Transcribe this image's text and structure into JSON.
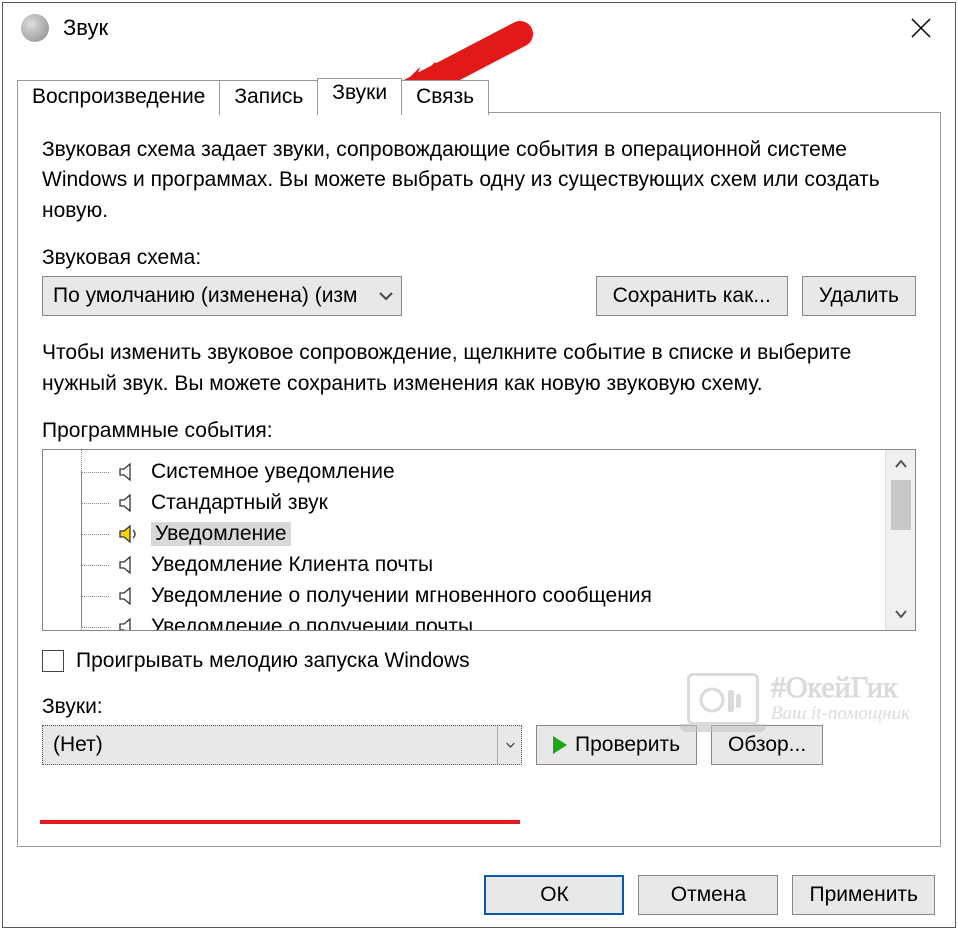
{
  "window": {
    "title": "Звук"
  },
  "tabs": [
    {
      "label": "Воспроизведение",
      "active": false
    },
    {
      "label": "Запись",
      "active": false
    },
    {
      "label": "Звуки",
      "active": true
    },
    {
      "label": "Связь",
      "active": false
    }
  ],
  "description": "Звуковая схема задает звуки, сопровождающие события в операционной системе Windows и программах. Вы можете выбрать одну из существующих схем или создать новую.",
  "scheme": {
    "label": "Звуковая схема:",
    "value": "По умолчанию (изменена) (изм",
    "save_as": "Сохранить как...",
    "delete": "Удалить"
  },
  "events_help": "Чтобы изменить звуковое сопровождение, щелкните событие в списке и выберите нужный звук. Вы можете сохранить изменения как новую звуковую схему.",
  "events_label": "Программные события:",
  "events": [
    {
      "label": "Системное уведомление",
      "has_sound": false,
      "selected": false
    },
    {
      "label": "Стандартный звук",
      "has_sound": false,
      "selected": false
    },
    {
      "label": "Уведомление",
      "has_sound": true,
      "selected": true
    },
    {
      "label": "Уведомление Клиента почты",
      "has_sound": false,
      "selected": false
    },
    {
      "label": "Уведомление о получении мгновенного сообщения",
      "has_sound": false,
      "selected": false
    },
    {
      "label": "Уведомление о получении почты",
      "has_sound": false,
      "selected": false
    }
  ],
  "play_startup": {
    "label": "Проигрывать мелодию запуска Windows",
    "checked": false
  },
  "sounds": {
    "label": "Звуки:",
    "value": "(Нет)",
    "test": "Проверить",
    "browse": "Обзор..."
  },
  "footer": {
    "ok": "ОК",
    "cancel": "Отмена",
    "apply": "Применить"
  },
  "watermark": {
    "line1": "#ОкейГик",
    "line2": "Ваш it-помощник"
  }
}
